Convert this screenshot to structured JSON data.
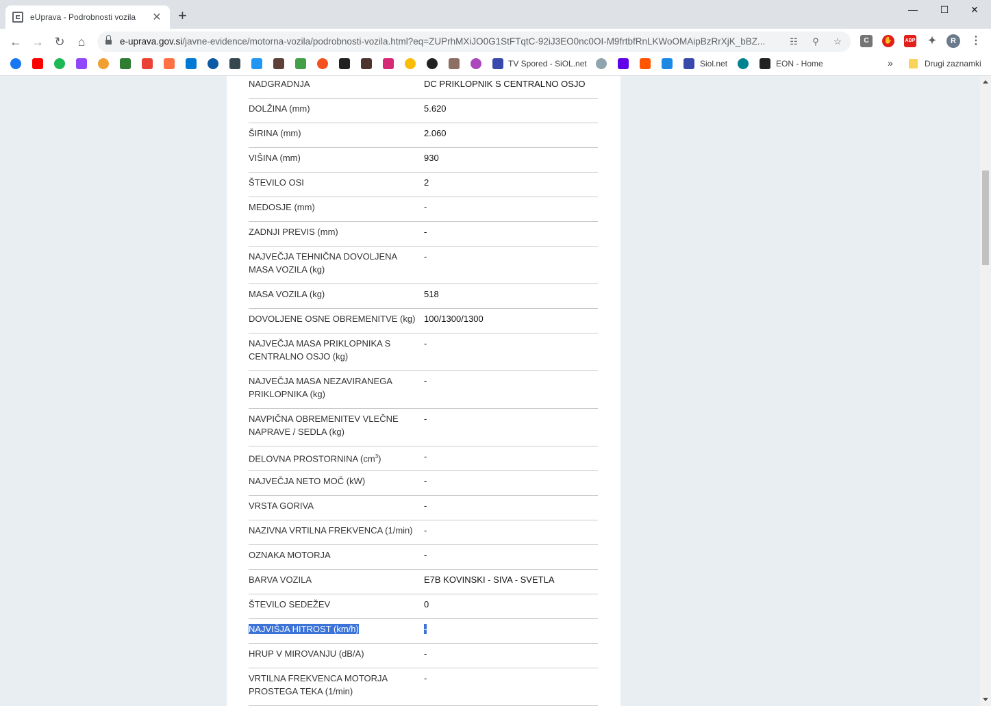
{
  "browser": {
    "tab_title": "eUprava - Podrobnosti vozila",
    "tab_close": "✕",
    "new_tab": "+",
    "url_host": "e-uprava.gov.si",
    "url_path": "/javne-evidence/motorna-vozila/podrobnosti-vozila.html?eq=ZUPrhMXiJO0G1StFTqtC-92iJ3EO0nc0OI-M9frtbfRnLKWoOMAipBzRrXjK_bBZ...",
    "profile_initial": "R",
    "bookmarks": [
      {
        "label": "TV Spored - SiOL.net"
      },
      {
        "label": "Siol.net"
      },
      {
        "label": "EON - Home"
      }
    ],
    "more_bookmarks": "»",
    "other_bookmarks": "Drugi zaznamki"
  },
  "vehicle": {
    "rows": [
      {
        "label": "NADGRADNJA",
        "value": "DC PRIKLOPNIK S CENTRALNO OSJO"
      },
      {
        "label": "DOLŽINA (mm)",
        "value": "5.620"
      },
      {
        "label": "ŠIRINA (mm)",
        "value": "2.060"
      },
      {
        "label": "VIŠINA (mm)",
        "value": "930"
      },
      {
        "label": "ŠTEVILO OSI",
        "value": "2"
      },
      {
        "label": "MEDOSJE (mm)",
        "value": "-"
      },
      {
        "label": "ZADNJI PREVIS (mm)",
        "value": "-"
      },
      {
        "label": "NAJVEČJA TEHNIČNA DOVOLJENA MASA VOZILA (kg)",
        "value": "-"
      },
      {
        "label": "MASA VOZILA (kg)",
        "value": "518"
      },
      {
        "label": "DOVOLJENE OSNE OBREMENITVE (kg)",
        "value": "100/1300/1300"
      },
      {
        "label": "NAJVEČJA MASA PRIKLOPNIKA S CENTRALNO OSJO (kg)",
        "value": "-"
      },
      {
        "label": "NAJVEČJA MASA NEZAVIRANEGA PRIKLOPNIKA (kg)",
        "value": "-"
      },
      {
        "label": "NAVPIČNA OBREMENITEV VLEČNE NAPRAVE / SEDLA (kg)",
        "value": "-"
      },
      {
        "label": "DELOVNA PROSTORNINA (cm",
        "label_sup": "3",
        "label_suffix": ")",
        "value": "-"
      },
      {
        "label": "NAJVEČJA NETO MOČ (kW)",
        "value": "-"
      },
      {
        "label": "VRSTA GORIVA",
        "value": "-"
      },
      {
        "label": "NAZIVNA VRTILNA FREKVENCA (1/min)",
        "value": "-"
      },
      {
        "label": "OZNAKA MOTORJA",
        "value": "-"
      },
      {
        "label": "BARVA VOZILA",
        "value": "E7B KOVINSKI - SIVA - SVETLA"
      },
      {
        "label": "ŠTEVILO SEDEŽEV",
        "value": "0"
      },
      {
        "label": "NAJVIŠJA HITROST (km/h)",
        "value": "-",
        "selected": true
      },
      {
        "label": "HRUP V MIROVANJU (dB/A)",
        "value": "-"
      },
      {
        "label": "VRTILNA FREKVENCA MOTORJA PROSTEGA TEKA (1/min)",
        "value": "-"
      }
    ]
  }
}
